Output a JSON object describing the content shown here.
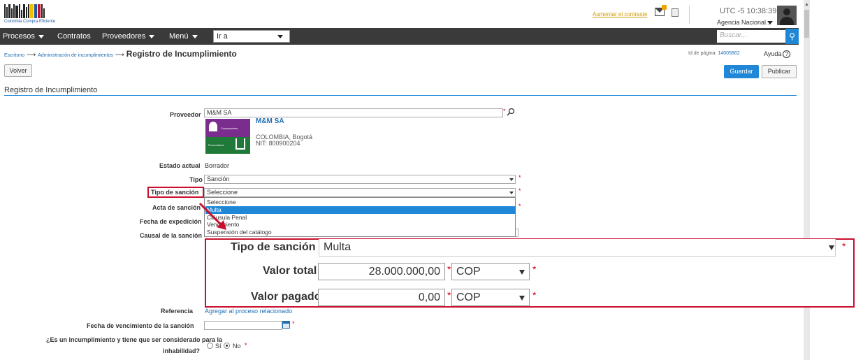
{
  "header": {
    "logo_text": "Colombia Compra Eficiente",
    "font_link": "Aumentar el contraste",
    "clock": "UTC -5 10:38:39",
    "agency": "Agencia Nacional..."
  },
  "nav": {
    "items": [
      "Procesos",
      "Contratos",
      "Proveedores",
      "Menú"
    ],
    "goto_value": "Ir a",
    "search_placeholder": "Buscar..."
  },
  "breadcrumb": {
    "items": [
      "Escritorio",
      "Administración de incumplimientos"
    ],
    "current": "Registro de Incumplimiento",
    "page_id_label": "Id de página:",
    "page_id": "14005862",
    "help": "Ayuda"
  },
  "buttons": {
    "volver": "Volver",
    "guardar": "Guardar",
    "publicar": "Publicar"
  },
  "section_title": "Registro de Incumplimiento",
  "form": {
    "proveedor_label": "Proveedor",
    "proveedor_value": "M&M SA",
    "proveedor_name": "M&M SA",
    "proveedor_location": "COLOMBIA, Bogotá",
    "proveedor_nit": "NIT: 800900204",
    "logo_top_text": "Compradores",
    "logo_bottom_text": "Proveedores",
    "estado_label": "Estado actual",
    "estado_value": "Borrador",
    "tipo_label": "Tipo",
    "tipo_value": "Sanción",
    "tipo_sancion_label": "Tipo de sanción",
    "tipo_sancion_value": "Seleccione",
    "tipo_sancion_options": [
      "Seleccione",
      "Multa",
      "Cláusula Penal",
      "Vencimiento",
      "Suspensión del catálogo"
    ],
    "acta_label": "Acta de sanción",
    "fecha_exp_label": "Fecha de expedición",
    "causal_label": "Causal de la sanción",
    "referencia_label": "Referencia",
    "referencia_link": "Agregar al proceso relacionado",
    "fecha_venc_label": "Fecha de vencimiento de la sanción",
    "incumplimiento_label_1": "¿Es un incumplimiento y tiene que ser considerado para la",
    "incumplimiento_label_2": "inhabilidad?",
    "radio_si": "Sí",
    "radio_no": "No",
    "required_mark": "*"
  },
  "zoom": {
    "tipo_sancion_label": "Tipo de sanción",
    "tipo_sancion_value": "Multa",
    "valor_total_label": "Valor total",
    "valor_total_value": "28.000.000,00",
    "valor_total_currency": "COP",
    "valor_pagado_label": "Valor pagado",
    "valor_pagado_value": "0,00",
    "valor_pagado_currency": "COP"
  },
  "colors": {
    "highlight": "#c8102e",
    "accent": "#1f87d6",
    "navbar": "#3a3a3a"
  }
}
